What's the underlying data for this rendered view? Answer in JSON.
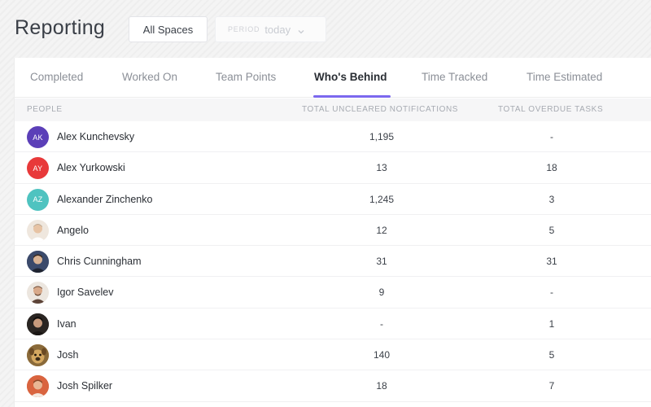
{
  "header": {
    "title": "Reporting",
    "spaces_label": "All Spaces",
    "period_label": "PERIOD",
    "period_value": "today"
  },
  "tabs": [
    {
      "label": "Completed",
      "active": false
    },
    {
      "label": "Worked On",
      "active": false
    },
    {
      "label": "Team Points",
      "active": false
    },
    {
      "label": "Who's Behind",
      "active": true
    },
    {
      "label": "Time Tracked",
      "active": false
    },
    {
      "label": "Time Estimated",
      "active": false
    }
  ],
  "table": {
    "columns": [
      "PEOPLE",
      "TOTAL UNCLEARED NOTIFICATIONS",
      "TOTAL OVERDUE TASKS"
    ],
    "rows": [
      {
        "name": "Alex Kunchevsky",
        "initials": "AK",
        "avatar_color": "#5b3fb8",
        "notifications": "1,195",
        "overdue": "-"
      },
      {
        "name": "Alex Yurkowski",
        "initials": "AY",
        "avatar_color": "#e8393a",
        "notifications": "13",
        "overdue": "18"
      },
      {
        "name": "Alexander Zinchenko",
        "initials": "AZ",
        "avatar_color": "#4fc3c0",
        "notifications": "1,245",
        "overdue": "3"
      },
      {
        "name": "Angelo",
        "initials": "",
        "avatar_color": "#e9dfd4",
        "notifications": "12",
        "overdue": "5"
      },
      {
        "name": "Chris Cunningham",
        "initials": "",
        "avatar_color": "#3b4a6b",
        "notifications": "31",
        "overdue": "31"
      },
      {
        "name": "Igor Savelev",
        "initials": "",
        "avatar_color": "#d9c2ad",
        "notifications": "9",
        "overdue": "-"
      },
      {
        "name": "Ivan",
        "initials": "",
        "avatar_color": "#2a2522",
        "notifications": "-",
        "overdue": "1"
      },
      {
        "name": "Josh",
        "initials": "",
        "avatar_color": "#c99a4e",
        "notifications": "140",
        "overdue": "5"
      },
      {
        "name": "Josh Spilker",
        "initials": "",
        "avatar_color": "#d9643f",
        "notifications": "18",
        "overdue": "7"
      }
    ]
  },
  "colors": {
    "accent": "#7b68ee",
    "text_primary": "#2a2e34",
    "text_muted": "#8b8f97",
    "header_bg": "#f6f6f7"
  }
}
